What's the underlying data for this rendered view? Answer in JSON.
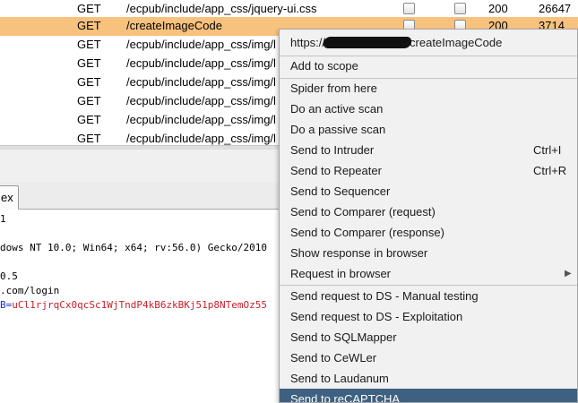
{
  "history": {
    "rows": [
      {
        "method": "GET",
        "url": "/ecpub/include/app_css/jquery-ui.css",
        "status": "200",
        "length": "26647",
        "selected": false
      },
      {
        "method": "GET",
        "url": "/createImageCode",
        "status": "200",
        "length": "3714",
        "selected": true
      },
      {
        "method": "GET",
        "url": "/ecpub/include/app_css/img/l",
        "status": "",
        "length": "",
        "selected": false
      },
      {
        "method": "GET",
        "url": "/ecpub/include/app_css/img/l",
        "status": "",
        "length": "",
        "selected": false
      },
      {
        "method": "GET",
        "url": "/ecpub/include/app_css/img/l",
        "status": "",
        "length": "",
        "selected": false
      },
      {
        "method": "GET",
        "url": "/ecpub/include/app_css/img/l",
        "status": "",
        "length": "",
        "selected": false
      },
      {
        "method": "GET",
        "url": "/ecpub/include/app_css/img/l",
        "status": "",
        "length": "",
        "selected": false
      },
      {
        "method": "GET",
        "url": "/ecpub/include/app_css/img/l",
        "status": "",
        "length": "",
        "selected": false
      }
    ]
  },
  "tabs": {
    "hex_label": "ex"
  },
  "editor": {
    "line1": "1",
    "line2": "dows NT 10.0; Win64; x64; rv:56.0) Gecko/2010",
    "line3": "0.5",
    "line4": ".com/login",
    "line5_name": "B=",
    "line5_value": "uCl1rjrqCx0qcSc1WjTndP4kB6zkBKj51p8NTemOz55"
  },
  "context_menu": {
    "url_prefix": "https://",
    "url_suffix": "createImageCode",
    "items": [
      {
        "label": "Add to scope",
        "shortcut": ""
      },
      {
        "label": "Spider from here",
        "shortcut": ""
      },
      {
        "label": "Do an active scan",
        "shortcut": ""
      },
      {
        "label": "Do a passive scan",
        "shortcut": ""
      },
      {
        "label": "Send to Intruder",
        "shortcut": "Ctrl+I"
      },
      {
        "label": "Send to Repeater",
        "shortcut": "Ctrl+R"
      },
      {
        "label": "Send to Sequencer",
        "shortcut": ""
      },
      {
        "label": "Send to Comparer (request)",
        "shortcut": ""
      },
      {
        "label": "Send to Comparer (response)",
        "shortcut": ""
      },
      {
        "label": "Show response in browser",
        "shortcut": ""
      },
      {
        "label": "Request in browser",
        "shortcut": ""
      },
      {
        "label": "Send request to DS - Manual testing",
        "shortcut": ""
      },
      {
        "label": "Send request to DS - Exploitation",
        "shortcut": ""
      },
      {
        "label": "Send to SQLMapper",
        "shortcut": ""
      },
      {
        "label": "Send to CeWLer",
        "shortcut": ""
      },
      {
        "label": "Send to Laudanum",
        "shortcut": ""
      },
      {
        "label": "Send to reCAPTCHA",
        "shortcut": ""
      }
    ],
    "active_index": 16,
    "submenu_arrow_icon": "triangle-right-icon",
    "highlight_color": "#3f6181"
  },
  "colors": {
    "selected_row": "#f7c27e",
    "header_name": "#1b2be8",
    "header_value": "#c8202a"
  }
}
